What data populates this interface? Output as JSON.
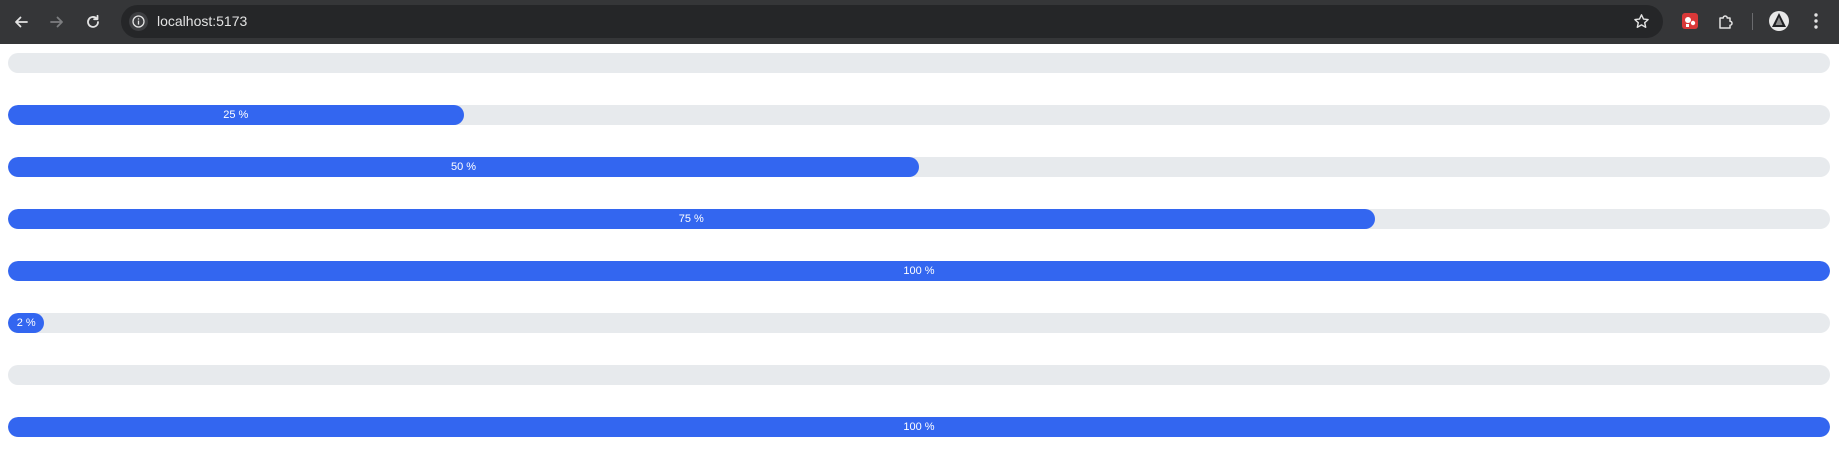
{
  "browser": {
    "url": "localhost:5173",
    "icons": {
      "back": "arrow-left-icon",
      "forward": "arrow-right-icon",
      "reload": "reload-icon",
      "site_info": "info-icon",
      "bookmark": "star-icon",
      "extension_red": "red-extension-icon",
      "extensions": "puzzle-icon",
      "profile": "profile-avatar",
      "menu": "kebab-menu-icon"
    }
  },
  "progress_bars": [
    {
      "percent": 0,
      "label": ""
    },
    {
      "percent": 25,
      "label": "25 %"
    },
    {
      "percent": 50,
      "label": "50 %"
    },
    {
      "percent": 75,
      "label": "75 %"
    },
    {
      "percent": 100,
      "label": "100 %"
    },
    {
      "percent": 2,
      "label": "2 %"
    },
    {
      "percent": 0,
      "label": ""
    },
    {
      "percent": 100,
      "label": "100 %"
    }
  ],
  "colors": {
    "fill": "#3366f0",
    "track": "#e7eaed",
    "label": "#ffffff",
    "toolbar": "#353638",
    "omnibox": "#252628"
  }
}
